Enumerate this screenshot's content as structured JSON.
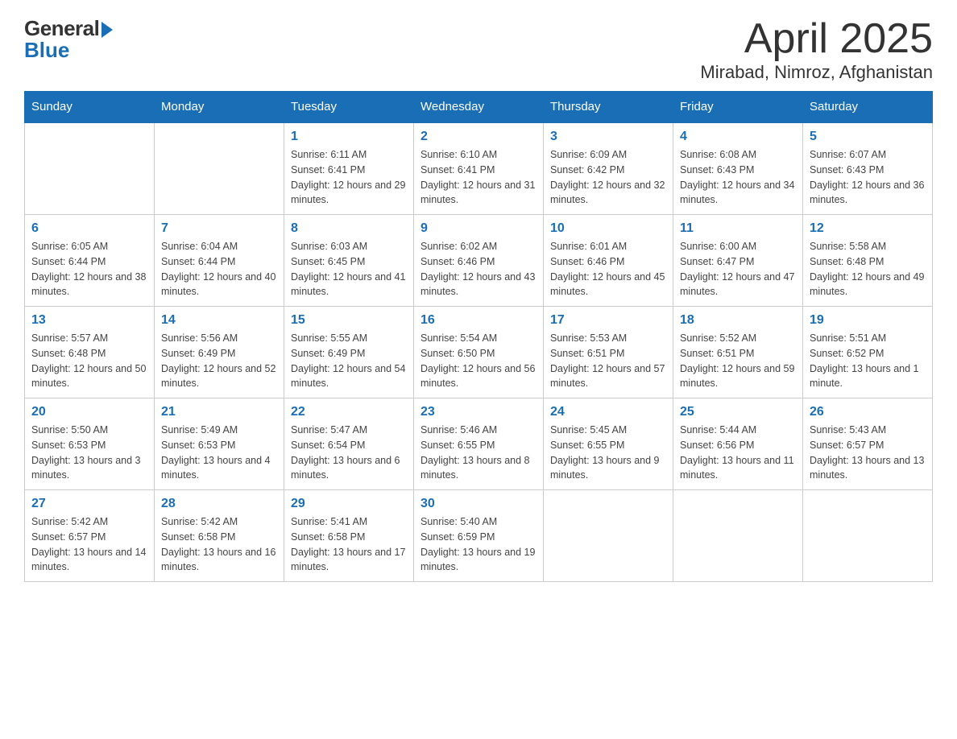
{
  "header": {
    "title": "April 2025",
    "subtitle": "Mirabad, Nimroz, Afghanistan",
    "logo_general": "General",
    "logo_blue": "Blue"
  },
  "days_of_week": [
    "Sunday",
    "Monday",
    "Tuesday",
    "Wednesday",
    "Thursday",
    "Friday",
    "Saturday"
  ],
  "weeks": [
    [
      {
        "day": "",
        "sunrise": "",
        "sunset": "",
        "daylight": ""
      },
      {
        "day": "",
        "sunrise": "",
        "sunset": "",
        "daylight": ""
      },
      {
        "day": "1",
        "sunrise": "Sunrise: 6:11 AM",
        "sunset": "Sunset: 6:41 PM",
        "daylight": "Daylight: 12 hours and 29 minutes."
      },
      {
        "day": "2",
        "sunrise": "Sunrise: 6:10 AM",
        "sunset": "Sunset: 6:41 PM",
        "daylight": "Daylight: 12 hours and 31 minutes."
      },
      {
        "day": "3",
        "sunrise": "Sunrise: 6:09 AM",
        "sunset": "Sunset: 6:42 PM",
        "daylight": "Daylight: 12 hours and 32 minutes."
      },
      {
        "day": "4",
        "sunrise": "Sunrise: 6:08 AM",
        "sunset": "Sunset: 6:43 PM",
        "daylight": "Daylight: 12 hours and 34 minutes."
      },
      {
        "day": "5",
        "sunrise": "Sunrise: 6:07 AM",
        "sunset": "Sunset: 6:43 PM",
        "daylight": "Daylight: 12 hours and 36 minutes."
      }
    ],
    [
      {
        "day": "6",
        "sunrise": "Sunrise: 6:05 AM",
        "sunset": "Sunset: 6:44 PM",
        "daylight": "Daylight: 12 hours and 38 minutes."
      },
      {
        "day": "7",
        "sunrise": "Sunrise: 6:04 AM",
        "sunset": "Sunset: 6:44 PM",
        "daylight": "Daylight: 12 hours and 40 minutes."
      },
      {
        "day": "8",
        "sunrise": "Sunrise: 6:03 AM",
        "sunset": "Sunset: 6:45 PM",
        "daylight": "Daylight: 12 hours and 41 minutes."
      },
      {
        "day": "9",
        "sunrise": "Sunrise: 6:02 AM",
        "sunset": "Sunset: 6:46 PM",
        "daylight": "Daylight: 12 hours and 43 minutes."
      },
      {
        "day": "10",
        "sunrise": "Sunrise: 6:01 AM",
        "sunset": "Sunset: 6:46 PM",
        "daylight": "Daylight: 12 hours and 45 minutes."
      },
      {
        "day": "11",
        "sunrise": "Sunrise: 6:00 AM",
        "sunset": "Sunset: 6:47 PM",
        "daylight": "Daylight: 12 hours and 47 minutes."
      },
      {
        "day": "12",
        "sunrise": "Sunrise: 5:58 AM",
        "sunset": "Sunset: 6:48 PM",
        "daylight": "Daylight: 12 hours and 49 minutes."
      }
    ],
    [
      {
        "day": "13",
        "sunrise": "Sunrise: 5:57 AM",
        "sunset": "Sunset: 6:48 PM",
        "daylight": "Daylight: 12 hours and 50 minutes."
      },
      {
        "day": "14",
        "sunrise": "Sunrise: 5:56 AM",
        "sunset": "Sunset: 6:49 PM",
        "daylight": "Daylight: 12 hours and 52 minutes."
      },
      {
        "day": "15",
        "sunrise": "Sunrise: 5:55 AM",
        "sunset": "Sunset: 6:49 PM",
        "daylight": "Daylight: 12 hours and 54 minutes."
      },
      {
        "day": "16",
        "sunrise": "Sunrise: 5:54 AM",
        "sunset": "Sunset: 6:50 PM",
        "daylight": "Daylight: 12 hours and 56 minutes."
      },
      {
        "day": "17",
        "sunrise": "Sunrise: 5:53 AM",
        "sunset": "Sunset: 6:51 PM",
        "daylight": "Daylight: 12 hours and 57 minutes."
      },
      {
        "day": "18",
        "sunrise": "Sunrise: 5:52 AM",
        "sunset": "Sunset: 6:51 PM",
        "daylight": "Daylight: 12 hours and 59 minutes."
      },
      {
        "day": "19",
        "sunrise": "Sunrise: 5:51 AM",
        "sunset": "Sunset: 6:52 PM",
        "daylight": "Daylight: 13 hours and 1 minute."
      }
    ],
    [
      {
        "day": "20",
        "sunrise": "Sunrise: 5:50 AM",
        "sunset": "Sunset: 6:53 PM",
        "daylight": "Daylight: 13 hours and 3 minutes."
      },
      {
        "day": "21",
        "sunrise": "Sunrise: 5:49 AM",
        "sunset": "Sunset: 6:53 PM",
        "daylight": "Daylight: 13 hours and 4 minutes."
      },
      {
        "day": "22",
        "sunrise": "Sunrise: 5:47 AM",
        "sunset": "Sunset: 6:54 PM",
        "daylight": "Daylight: 13 hours and 6 minutes."
      },
      {
        "day": "23",
        "sunrise": "Sunrise: 5:46 AM",
        "sunset": "Sunset: 6:55 PM",
        "daylight": "Daylight: 13 hours and 8 minutes."
      },
      {
        "day": "24",
        "sunrise": "Sunrise: 5:45 AM",
        "sunset": "Sunset: 6:55 PM",
        "daylight": "Daylight: 13 hours and 9 minutes."
      },
      {
        "day": "25",
        "sunrise": "Sunrise: 5:44 AM",
        "sunset": "Sunset: 6:56 PM",
        "daylight": "Daylight: 13 hours and 11 minutes."
      },
      {
        "day": "26",
        "sunrise": "Sunrise: 5:43 AM",
        "sunset": "Sunset: 6:57 PM",
        "daylight": "Daylight: 13 hours and 13 minutes."
      }
    ],
    [
      {
        "day": "27",
        "sunrise": "Sunrise: 5:42 AM",
        "sunset": "Sunset: 6:57 PM",
        "daylight": "Daylight: 13 hours and 14 minutes."
      },
      {
        "day": "28",
        "sunrise": "Sunrise: 5:42 AM",
        "sunset": "Sunset: 6:58 PM",
        "daylight": "Daylight: 13 hours and 16 minutes."
      },
      {
        "day": "29",
        "sunrise": "Sunrise: 5:41 AM",
        "sunset": "Sunset: 6:58 PM",
        "daylight": "Daylight: 13 hours and 17 minutes."
      },
      {
        "day": "30",
        "sunrise": "Sunrise: 5:40 AM",
        "sunset": "Sunset: 6:59 PM",
        "daylight": "Daylight: 13 hours and 19 minutes."
      },
      {
        "day": "",
        "sunrise": "",
        "sunset": "",
        "daylight": ""
      },
      {
        "day": "",
        "sunrise": "",
        "sunset": "",
        "daylight": ""
      },
      {
        "day": "",
        "sunrise": "",
        "sunset": "",
        "daylight": ""
      }
    ]
  ]
}
